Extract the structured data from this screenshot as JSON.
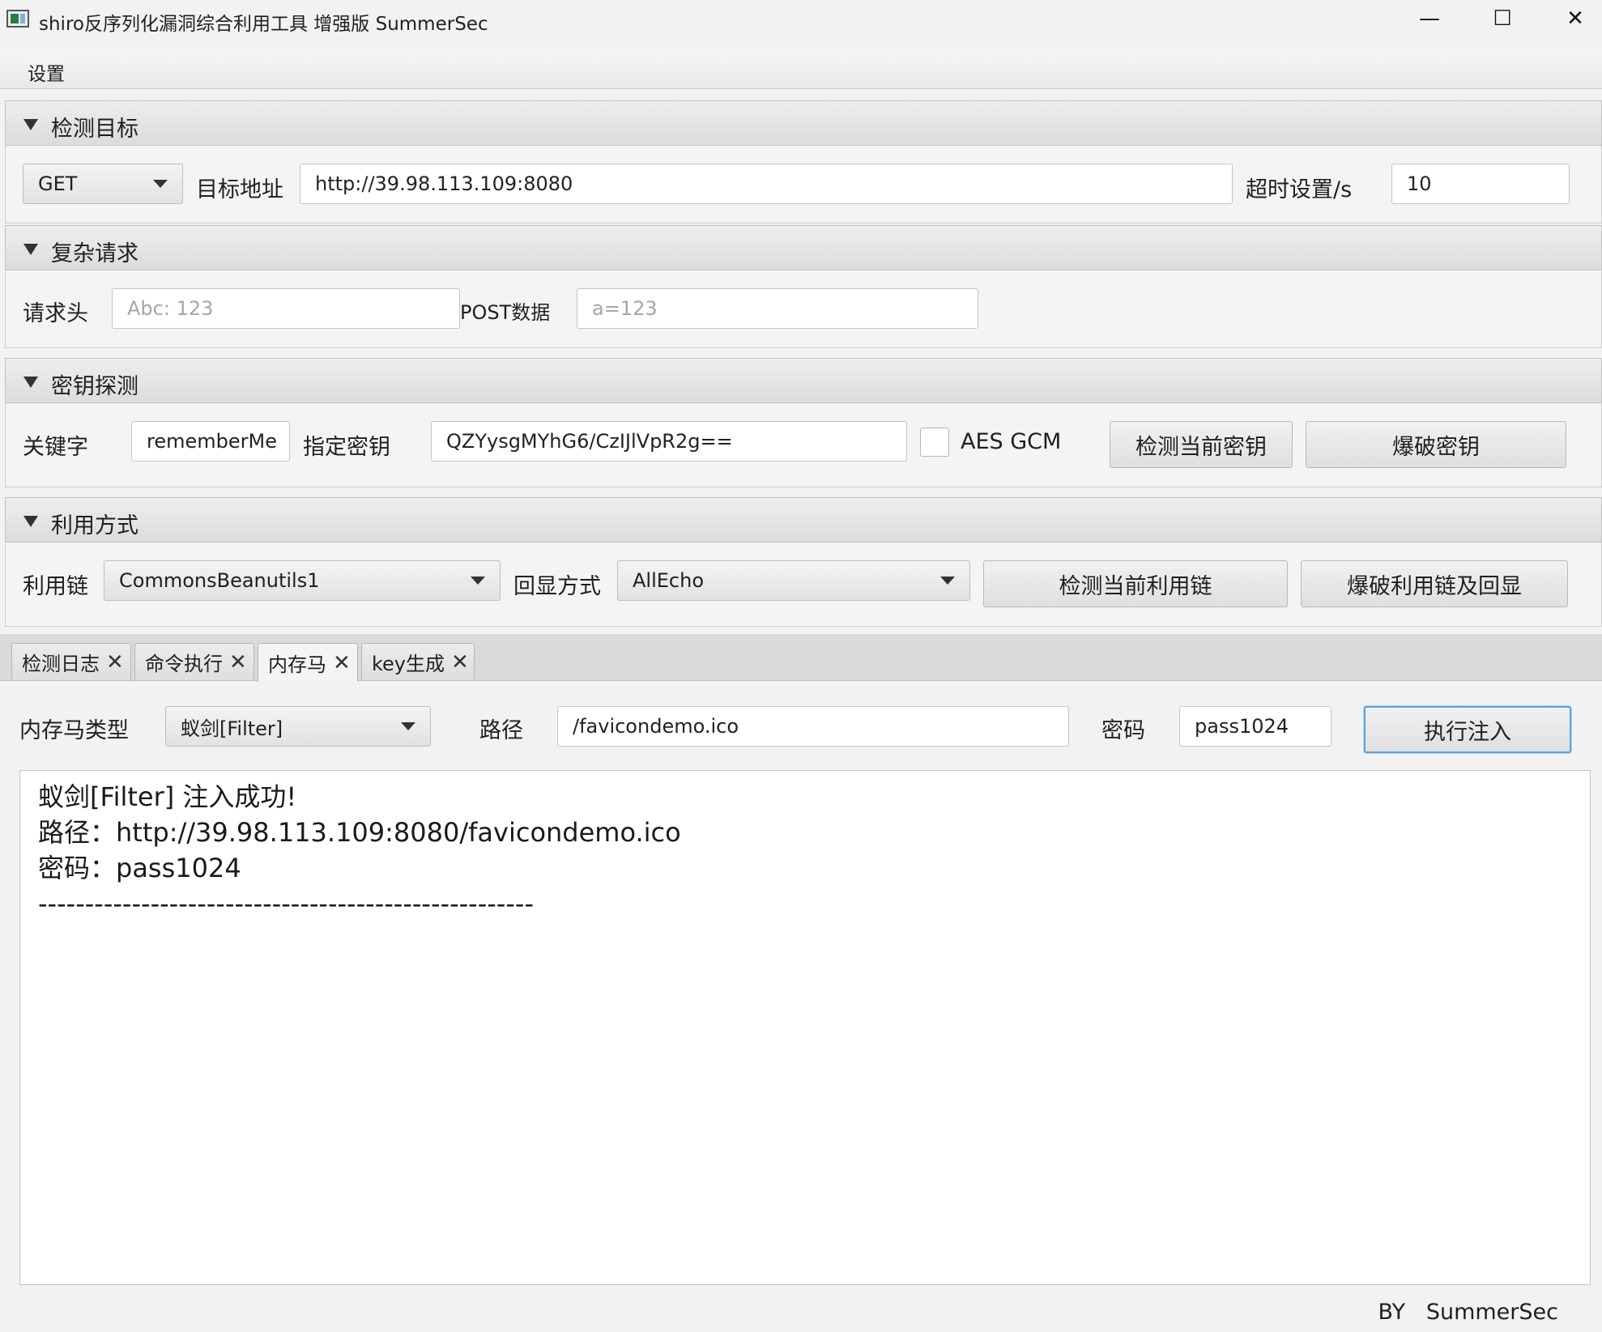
{
  "window": {
    "title": "shiro反序列化漏洞综合利用工具 增强版 SummerSec",
    "minimize": "—",
    "maximize": "☐",
    "close": "✕"
  },
  "menu": {
    "settings": "设置"
  },
  "sections": {
    "target": {
      "title": "检测目标",
      "method": "GET",
      "url_label": "目标地址",
      "url_value": "http://39.98.113.109:8080",
      "timeout_label": "超时设置/s",
      "timeout_value": "10"
    },
    "complex": {
      "title": "复杂请求",
      "header_label": "请求头",
      "header_placeholder": "Abc: 123",
      "post_label": "POST数据",
      "post_placeholder": "a=123"
    },
    "key": {
      "title": "密钥探测",
      "keyword_label": "关键字",
      "keyword_value": "rememberMe",
      "key_label": "指定密钥",
      "key_value": "QZYysgMYhG6/CzIJlVpR2g==",
      "aes_gcm_label": "AES GCM",
      "aes_gcm_checked": false,
      "check_button": "检测当前密钥",
      "brute_button": "爆破密钥"
    },
    "exploit": {
      "title": "利用方式",
      "chain_label": "利用链",
      "chain_value": "CommonsBeanutils1",
      "echo_label": "回显方式",
      "echo_value": "AllEcho",
      "check_button": "检测当前利用链",
      "brute_button": "爆破利用链及回显"
    }
  },
  "tabs": [
    {
      "label": "检测日志",
      "close": "✕"
    },
    {
      "label": "命令执行",
      "close": "✕"
    },
    {
      "label": "内存马",
      "close": "✕",
      "active": true
    },
    {
      "label": "key生成",
      "close": "✕"
    }
  ],
  "memshell": {
    "type_label": "内存马类型",
    "type_value": "蚁剑[Filter]",
    "path_label": "路径",
    "path_value": "/favicondemo.ico",
    "password_label": "密码",
    "password_value": "pass1024",
    "inject_button": "执行注入"
  },
  "output": {
    "lines": [
      "蚁剑[Filter]  注入成功!",
      "路径：http://39.98.113.109:8080/favicondemo.ico",
      "密码：pass1024",
      "-----------------------------------------------------"
    ]
  },
  "footer": "BY   SummerSec"
}
